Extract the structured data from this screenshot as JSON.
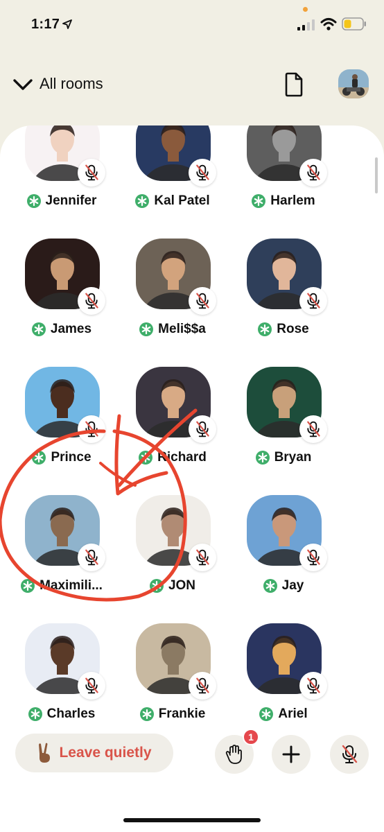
{
  "status_bar": {
    "time": "1:17",
    "icons": [
      "location-arrow-icon",
      "signal-icon",
      "wifi-icon",
      "battery-icon"
    ]
  },
  "header": {
    "title": "All rooms",
    "icons": [
      "chevron-down-icon",
      "document-icon",
      "profile-avatar"
    ]
  },
  "speakers": [
    {
      "name": "Jennifer",
      "skin": "#f0d2c0",
      "bg": "#f7f2f3"
    },
    {
      "name": "Kal Patel",
      "skin": "#8a5a3c",
      "bg": "#283a62"
    },
    {
      "name": "Harlem",
      "skin": "#9a9a9a",
      "bg": "#5e5e5e"
    },
    {
      "name": "James",
      "skin": "#c99a74",
      "bg": "#2a1b19"
    },
    {
      "name": "Meli$$a",
      "skin": "#d2a37d",
      "bg": "#6d6256"
    },
    {
      "name": "Rose",
      "skin": "#e1b69a",
      "bg": "#2f3f5a"
    },
    {
      "name": "Prince",
      "skin": "#4b2d1f",
      "bg": "#71b7e4"
    },
    {
      "name": "Richard",
      "skin": "#d8aa85",
      "bg": "#3a3540"
    },
    {
      "name": "Bryan",
      "skin": "#c8a07a",
      "bg": "#1d4d3b"
    },
    {
      "name": "Maximili...",
      "skin": "#8a6a50",
      "bg": "#8fb3cc"
    },
    {
      "name": "JON",
      "skin": "#b08b74",
      "bg": "#f0ede8"
    },
    {
      "name": "Jay",
      "skin": "#c9987a",
      "bg": "#6ea2d4"
    },
    {
      "name": "Charles",
      "skin": "#5a3a28",
      "bg": "#e8ecf4"
    },
    {
      "name": "Frankie",
      "skin": "#8b7a63",
      "bg": "#c8b9a1"
    },
    {
      "name": "Ariel",
      "skin": "#e3a95c",
      "bg": "#2a3560"
    }
  ],
  "toolbar": {
    "leave_label": "Leave quietly",
    "raise_hand_badge": "1",
    "accent": "#d9544a",
    "icons": [
      "victory-hand-icon",
      "raise-hand-icon",
      "plus-icon",
      "mic-muted-icon"
    ]
  },
  "colors": {
    "background": "#f1efe4",
    "sheet": "#ffffff",
    "badge_green": "#3fae6a",
    "notification_red": "#e5484d",
    "annotation_red": "#e7452f"
  }
}
